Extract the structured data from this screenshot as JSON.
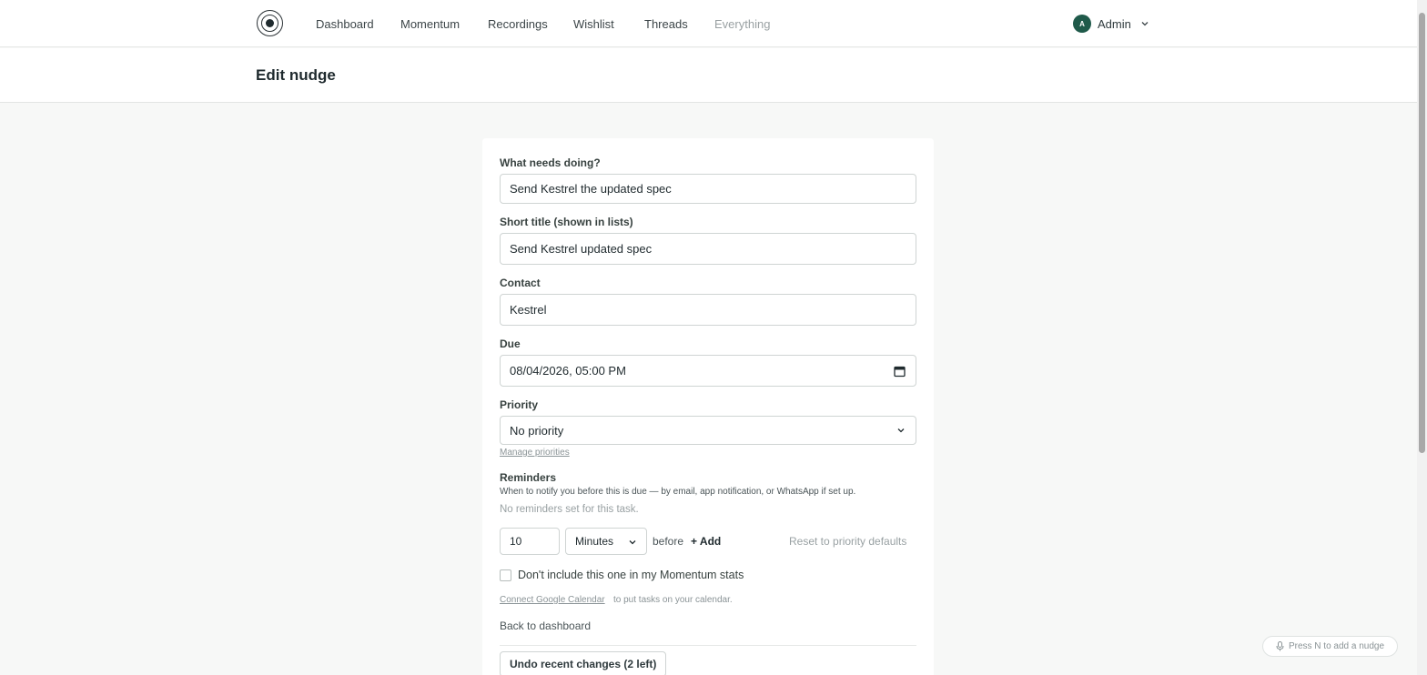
{
  "nav": {
    "items": [
      "Dashboard",
      "Momentum",
      "Recordings",
      "Wishlist",
      "Threads",
      "Everything"
    ],
    "user_initial": "A",
    "user_name": "Admin"
  },
  "page": {
    "title": "Edit nudge"
  },
  "form": {
    "what_label": "What needs doing?",
    "what_value": "Send Kestrel the updated spec",
    "short_label": "Short title (shown in lists)",
    "short_value": "Send Kestrel updated spec",
    "contact_label": "Contact",
    "contact_value": "Kestrel",
    "due_label": "Due",
    "due_value": "08/04/2026, 05:00 PM",
    "priority_label": "Priority",
    "priority_value": "No priority",
    "manage_priorities": "Manage priorities",
    "reminders_label": "Reminders",
    "reminders_help": "When to notify you before this is due — by email, app notification, or WhatsApp if set up.",
    "no_reminders": "No reminders set for this task.",
    "reminder_amount": "10",
    "reminder_unit": "Minutes",
    "before_text": "before",
    "add_label": "+ Add",
    "reset_label": "Reset to priority defaults",
    "momentum_checkbox_label": "Don't include this one in my Momentum stats",
    "connect_calendar_link": "Connect Google Calendar",
    "connect_calendar_rest": "to put tasks on your calendar.",
    "back_link": "Back to dashboard",
    "undo_label": "Undo recent changes (2 left)"
  },
  "hint": {
    "text": "Press N to add a nudge",
    "icon": "microphone-icon"
  },
  "colors": {
    "avatar": "#1f5a4a",
    "page_bg": "#f7f8f7",
    "border": "#cfd4d3"
  }
}
